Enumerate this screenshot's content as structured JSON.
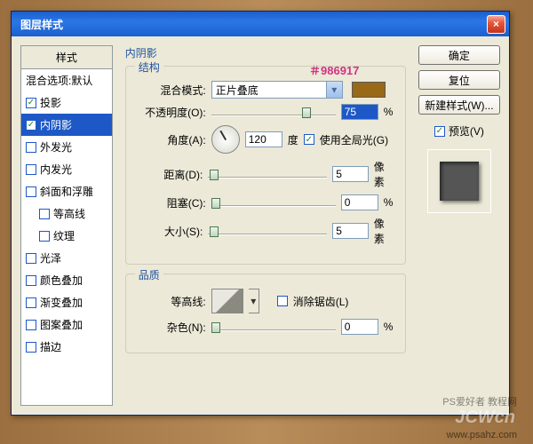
{
  "window": {
    "title": "图层样式"
  },
  "color_annotation": "＃986917",
  "swatch_color": "#986917",
  "left": {
    "header": "样式",
    "items": [
      {
        "label": "混合选项:默认",
        "checked": false,
        "hasCb": false,
        "sel": false
      },
      {
        "label": "投影",
        "checked": true,
        "hasCb": true,
        "sel": false
      },
      {
        "label": "内阴影",
        "checked": true,
        "hasCb": true,
        "sel": true
      },
      {
        "label": "外发光",
        "checked": false,
        "hasCb": true,
        "sel": false
      },
      {
        "label": "内发光",
        "checked": false,
        "hasCb": true,
        "sel": false
      },
      {
        "label": "斜面和浮雕",
        "checked": false,
        "hasCb": true,
        "sel": false
      },
      {
        "label": "等高线",
        "checked": false,
        "hasCb": true,
        "sel": false,
        "indent": true
      },
      {
        "label": "纹理",
        "checked": false,
        "hasCb": true,
        "sel": false,
        "indent": true
      },
      {
        "label": "光泽",
        "checked": false,
        "hasCb": true,
        "sel": false
      },
      {
        "label": "颜色叠加",
        "checked": false,
        "hasCb": true,
        "sel": false
      },
      {
        "label": "渐变叠加",
        "checked": false,
        "hasCb": true,
        "sel": false
      },
      {
        "label": "图案叠加",
        "checked": false,
        "hasCb": true,
        "sel": false
      },
      {
        "label": "描边",
        "checked": false,
        "hasCb": true,
        "sel": false
      }
    ]
  },
  "mid": {
    "section_title": "内阴影",
    "group_struct": "结构",
    "blend_label": "混合模式:",
    "blend_value": "正片叠底",
    "opacity_label": "不透明度(O):",
    "opacity_value": "75",
    "opacity_unit": "%",
    "angle_label": "角度(A):",
    "angle_value": "120",
    "angle_unit": "度",
    "global_light": "使用全局光(G)",
    "global_light_checked": true,
    "distance_label": "距离(D):",
    "distance_value": "5",
    "distance_unit": "像素",
    "choke_label": "阻塞(C):",
    "choke_value": "0",
    "choke_unit": "%",
    "size_label": "大小(S):",
    "size_value": "5",
    "size_unit": "像素",
    "group_quality": "品质",
    "contour_label": "等高线:",
    "antialias": "消除锯齿(L)",
    "antialias_checked": false,
    "noise_label": "杂色(N):",
    "noise_value": "0",
    "noise_unit": "%"
  },
  "right": {
    "ok": "确定",
    "cancel": "复位",
    "newstyle": "新建样式(W)...",
    "preview_label": "预览(V)",
    "preview_checked": true
  },
  "watermarks": {
    "w1": "JCWcn",
    "w2": "www.psahz.com",
    "w3": "PS爱好者 教程网"
  }
}
